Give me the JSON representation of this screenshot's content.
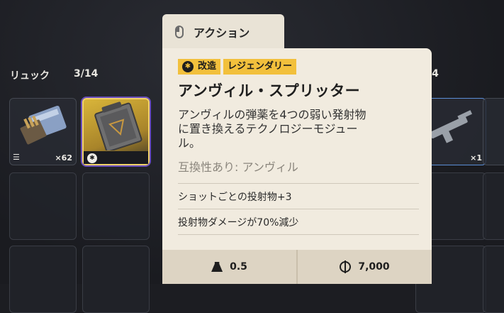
{
  "backpack": {
    "label": "リュック",
    "capacity": "3/14",
    "slot1_count": "×62"
  },
  "right_panel": {
    "capacity_partial": "/4",
    "slot_count": "×1"
  },
  "action_tab": {
    "label": "アクション"
  },
  "tooltip": {
    "tags": [
      "改造",
      "レジェンダリー"
    ],
    "title": "アンヴィル・スプリッター",
    "description_lines": [
      "アンヴィルの弾薬を4つの弱い発射物",
      "に置き換えるテクノロジーモジュー",
      "ル。"
    ],
    "compatibility": "互換性あり: アンヴィル",
    "stats": [
      "ショットごとの投射物+3",
      "投射物ダメージが70%減少"
    ],
    "weight": "0.5",
    "price": "7,000",
    "rarity_color": "#f2c03c"
  }
}
